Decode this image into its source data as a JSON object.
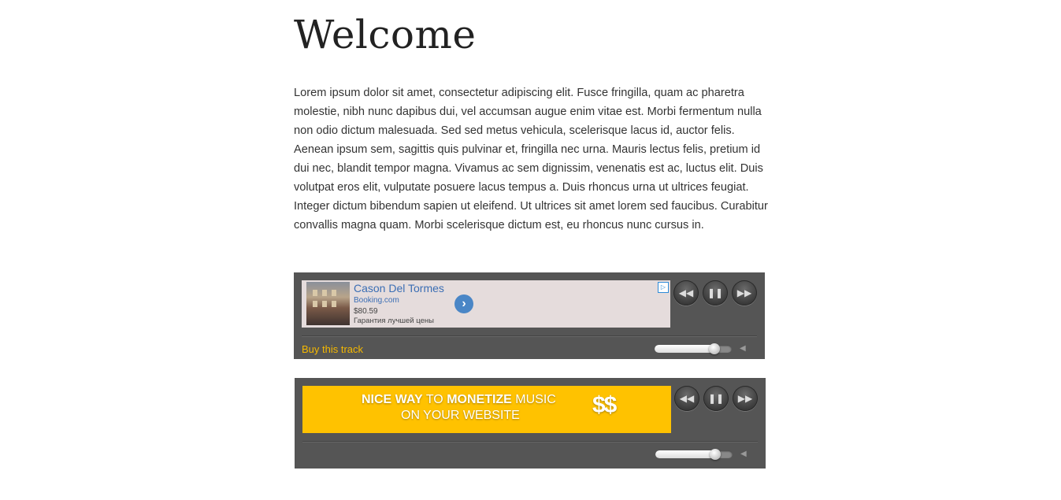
{
  "page": {
    "title": "Welcome",
    "body": "Lorem ipsum dolor sit amet, consectetur adipiscing elit. Fusce fringilla, quam ac pharetra molestie, nibh nunc dapibus dui, vel accumsan augue enim vitae est. Morbi fermentum nulla non odio dictum malesuada. Sed sed metus vehicula, scelerisque lacus id, auctor felis. Aenean ipsum sem, sagittis quis pulvinar et, fringilla nec urna. Mauris lectus felis, pretium id dui nec, blandit tempor magna. Vivamus ac sem dignissim, venenatis est ac, luctus elit. Duis volutpat eros elit, vulputate posuere lacus tempus a. Duis rhoncus urna ut ultrices feugiat. Integer dictum bibendum sapien ut eleifend. Ut ultrices sit amet lorem sed faucibus. Curabitur convallis magna quam. Morbi scelerisque dictum est, eu rhoncus nunc cursus in."
  },
  "player1": {
    "ad": {
      "name": "Cason Del Tormes",
      "site": "Booking.com",
      "price": "$80.59",
      "tagline": "Гарантия лучшей цены",
      "go_glyph": "›",
      "choices_glyph": "▷"
    },
    "controls": {
      "prev_icon": "rewind-icon",
      "pause_icon": "pause-icon",
      "next_icon": "fast-forward-icon",
      "prev_glyph": "◀◀",
      "pause_glyph": "❚❚",
      "next_glyph": "▶▶"
    },
    "buy_label": "Buy this track",
    "volume": 0.78,
    "speaker_glyph": "◀"
  },
  "player2": {
    "banner": {
      "line1_bold": "NICE WAY",
      "line1_mid": " TO ",
      "line1_bold2": "MONETIZE",
      "line1_end": " MUSIC",
      "line2": "ON YOUR WEBSITE",
      "money": "$$"
    },
    "controls": {
      "prev_glyph": "◀◀",
      "pause_glyph": "❚❚",
      "next_glyph": "▶▶"
    },
    "volume": 0.78,
    "speaker_glyph": "◀"
  },
  "colors": {
    "player_bg": "#555555",
    "buy_link": "#f5b800",
    "banner_bg": "#ffc200",
    "ad_bg": "#e5dcdc",
    "ad_link": "#3b6eb4"
  }
}
